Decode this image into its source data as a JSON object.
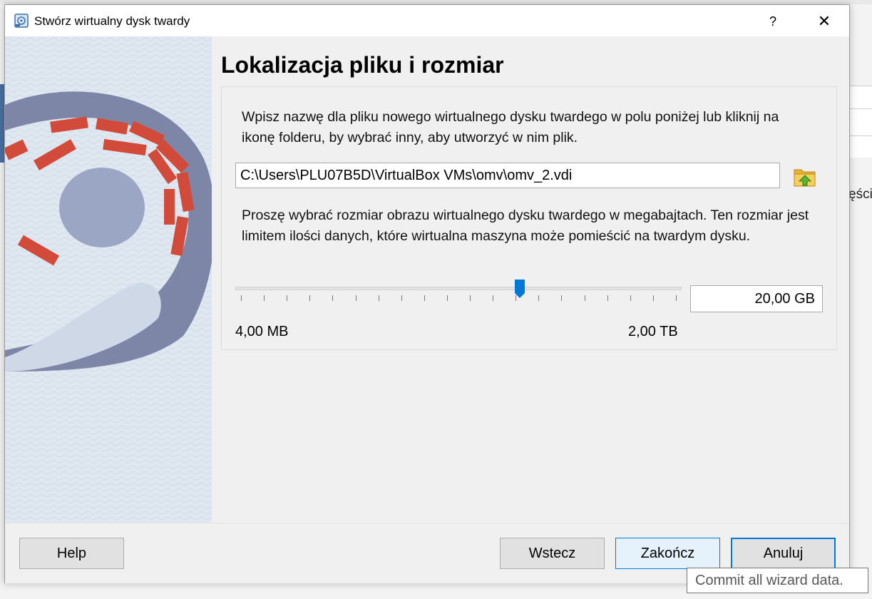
{
  "window": {
    "title": "Stwórz wirtualny dysk twardy",
    "help_glyph": "?",
    "close_glyph": "✕"
  },
  "page": {
    "title": "Lokalizacja pliku i rozmiar",
    "location_description": "Wpisz nazwę dla pliku nowego wirtualnego dysku twardego w polu poniżej lub kliknij na ikonę folderu, by wybrać inny, aby utworzyć w nim plik.",
    "file_path_value": "C:\\Users\\PLU07B5D\\VirtualBox VMs\\omv\\omv_2.vdi",
    "size_description": "Proszę wybrać rozmiar obrazu wirtualnego dysku twardego w megabajtach. Ten rozmiar jest limitem ilości danych, które wirtualna maszyna może pomieścić na twardym dysku.",
    "size_value": "20,00 GB",
    "slider_position_fraction": 0.637,
    "slider_min_label": "4,00 MB",
    "slider_max_label": "2,00 TB"
  },
  "footer": {
    "help_label": "Help",
    "back_label": "Wstecz",
    "finish_label": "Zakończ",
    "cancel_label": "Anuluj"
  },
  "tooltip": {
    "text": "Commit all wizard data."
  },
  "background": {
    "partial_text": "ęścia"
  },
  "colors": {
    "accent": "#0078d7",
    "art_stripe": "#d24a3a",
    "art_disk": "#7d86a6"
  },
  "icons": {
    "window": "virtualbox-disk-icon",
    "folder": "folder-open-icon",
    "slider": "slider-thumb"
  }
}
